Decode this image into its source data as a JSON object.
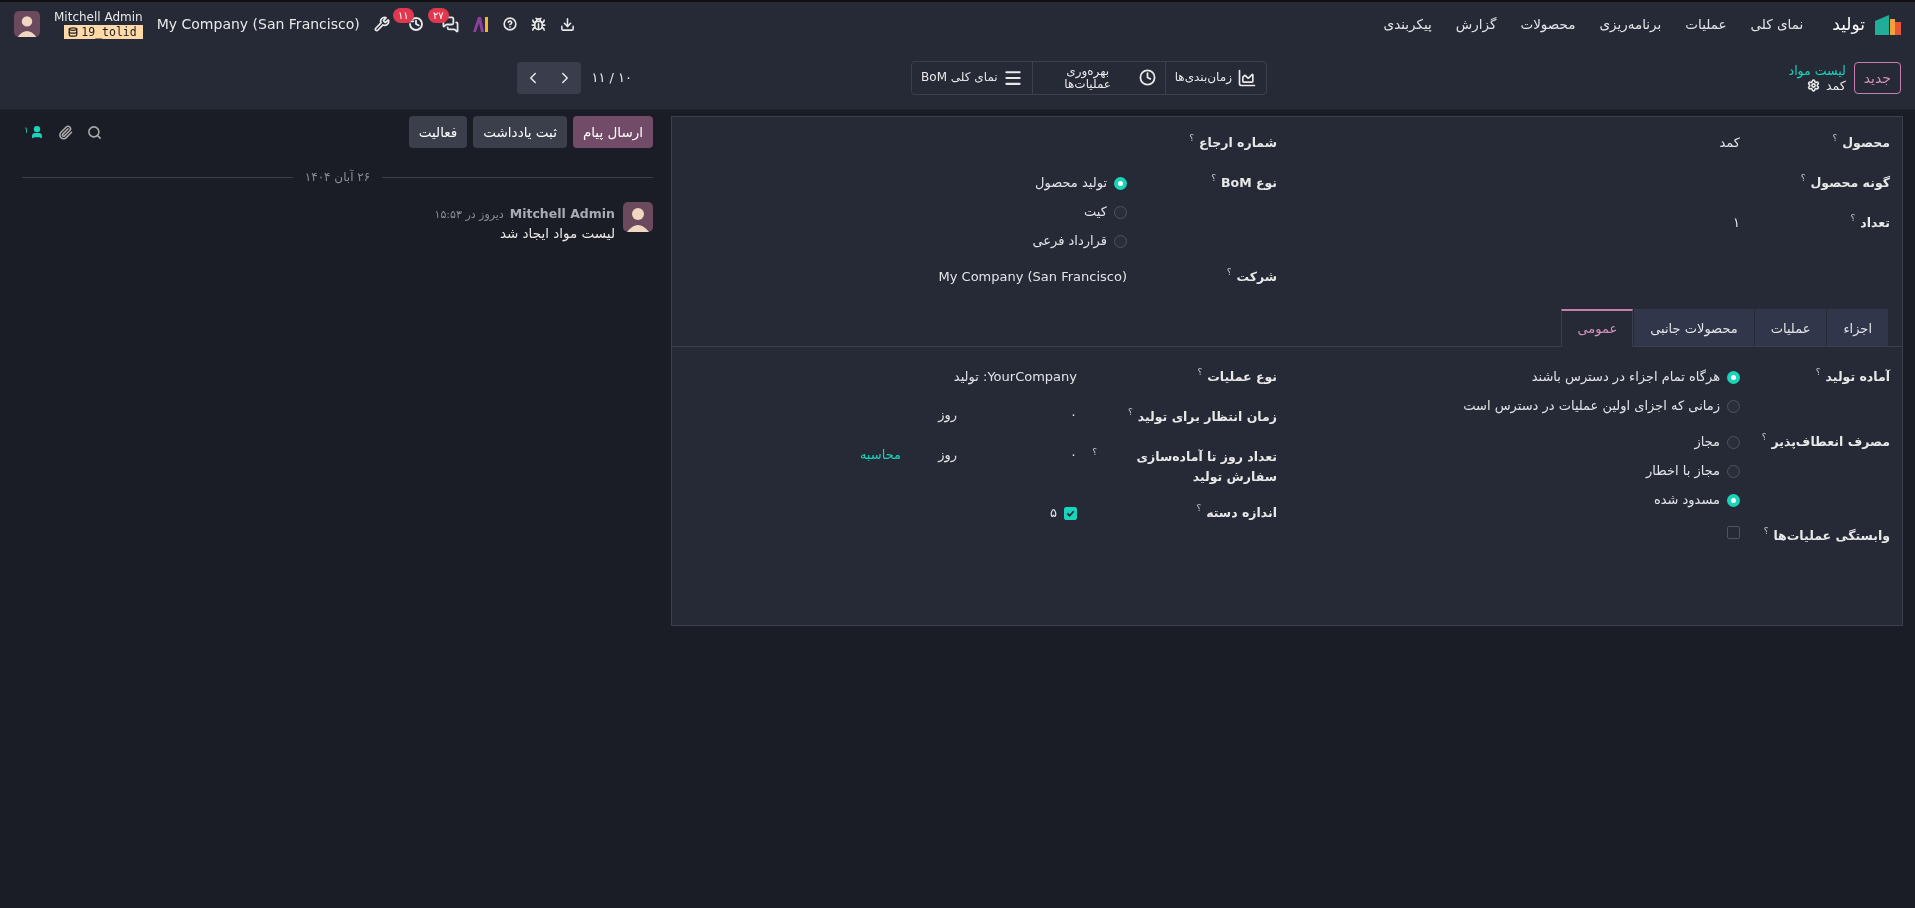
{
  "navbar": {
    "app_name": "تولید",
    "menu": [
      "نمای کلی",
      "عملیات",
      "برنامه‌ریزی",
      "محصولات",
      "گزارش",
      "پیکربندی"
    ],
    "chat_badge": "۲۷",
    "activity_badge": "۱۱",
    "company": "My Company (San Francisco)",
    "user": "Mitchell Admin",
    "database": "19_tolid"
  },
  "control_panel": {
    "new_button": "جدید",
    "breadcrumb": {
      "parent": "لیست مواد",
      "current": "کمد"
    },
    "view_buttons": [
      {
        "kind": "chart",
        "label": "زمان‌بندی‌ها"
      },
      {
        "kind": "clock",
        "label": "بهره‌وری عملیات‌ها"
      },
      {
        "kind": "list",
        "label": "نمای کلی BoM"
      }
    ],
    "pager": "۱۰ / ۱۱"
  },
  "form": {
    "right_fields": [
      {
        "label": "محصول",
        "help": "؟",
        "kind": "text",
        "value": "کمد"
      },
      {
        "label": "گونه محصول",
        "help": "؟",
        "kind": "text"
      },
      {
        "label": "تعداد",
        "help": "؟",
        "kind": "text",
        "value": "۱"
      }
    ],
    "left_fields": [
      {
        "label": "شماره ارجاع",
        "help": "؟",
        "kind": "text"
      },
      {
        "label": "نوع BoM",
        "help": "؟",
        "kind": "radio",
        "options": [
          {
            "label": "تولید محصول",
            "selected": true
          },
          {
            "label": "کیت",
            "selected": false
          },
          {
            "label": "قرارداد فرعی",
            "selected": false
          }
        ]
      },
      {
        "label": "شرکت",
        "help": "؟",
        "kind": "text",
        "value": "My Company (San Francisco)"
      }
    ],
    "tabs": [
      {
        "label": "اجزاء",
        "selected": false
      },
      {
        "label": "عملیات",
        "selected": false
      },
      {
        "label": "محصولات جانبی",
        "selected": false
      },
      {
        "label": "عمومی",
        "selected": true
      }
    ],
    "general": {
      "right_fields": [
        {
          "label": "آماده تولید",
          "help": "؟",
          "kind": "radio",
          "options": [
            {
              "label": "هرگاه تمام اجزاء در دسترس باشند",
              "selected": true
            },
            {
              "label": "زمانی که اجزای اولین عملیات در دسترس است",
              "selected": false
            }
          ]
        },
        {
          "label": "مصرف انعطاف‌پذیر",
          "help": "؟",
          "kind": "radio",
          "options": [
            {
              "label": "مجاز",
              "selected": false
            },
            {
              "label": "مجاز با اخطار",
              "selected": false
            },
            {
              "label": "مسدود شده",
              "selected": true
            }
          ]
        },
        {
          "label": "وابستگی عملیات‌ها",
          "help": "؟",
          "kind": "checkbox",
          "checked": false
        }
      ],
      "left_fields": [
        {
          "label": "نوع عملیات",
          "help": "؟",
          "kind": "text",
          "value": "YourCompany: تولید"
        },
        {
          "label": "زمان انتظار برای تولید",
          "help": "؟",
          "kind": "duration",
          "value": "۰",
          "unit": "روز"
        },
        {
          "label": "تعداد روز تا آماده‌سازی سفارش تولید",
          "help": "؟",
          "kind": "duration",
          "value": "۰",
          "unit": "روز",
          "action": "محاسبه"
        },
        {
          "label": "اندازه دسته",
          "help": "؟",
          "kind": "checkbox",
          "checked": true,
          "value": "۵"
        }
      ]
    }
  },
  "chatter": {
    "buttons": [
      {
        "label": "ارسال پیام",
        "selected": true
      },
      {
        "label": "ثبت یادداشت",
        "selected": false
      },
      {
        "label": "فعالیت",
        "selected": false
      }
    ],
    "followers": "۱",
    "date": "۲۶ آبان ۱۴۰۴",
    "messages": [
      {
        "author": "Mitchell Admin",
        "time": "دیروز در ۱۵:۵۳",
        "body": "لیست مواد ایجاد شد"
      }
    ]
  }
}
